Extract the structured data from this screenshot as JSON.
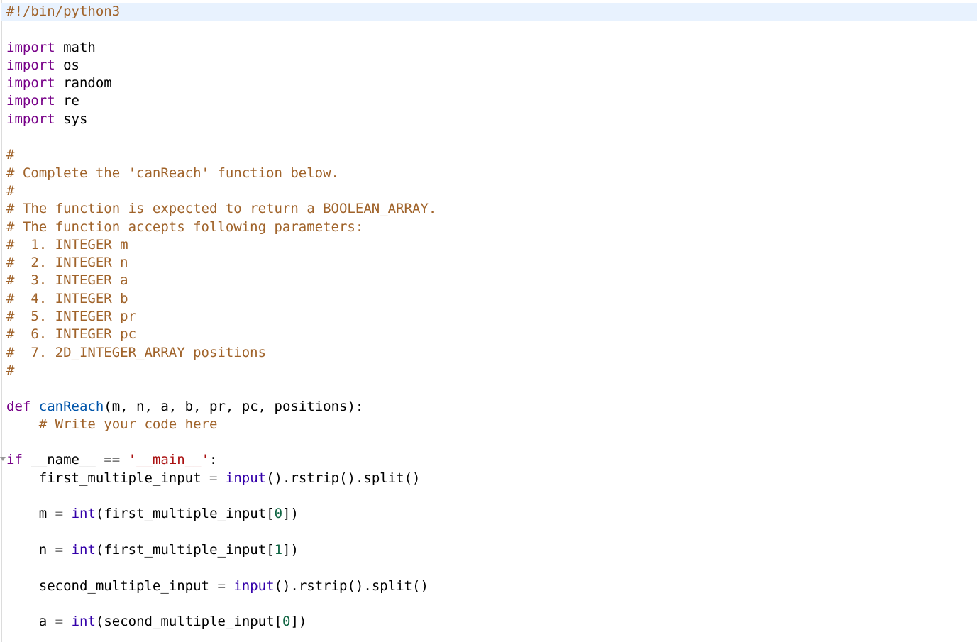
{
  "editor": {
    "language": "python",
    "colors": {
      "keyword": "#770088",
      "comment": "#a0632a",
      "function": "#0055aa",
      "builtin": "#3300aa",
      "string": "#aa1111",
      "number": "#116644",
      "current_line_bg": "#e8f2fe"
    },
    "lines": [
      "#!/bin/python3",
      "",
      "import math",
      "import os",
      "import random",
      "import re",
      "import sys",
      "",
      "#",
      "# Complete the 'canReach' function below.",
      "#",
      "# The function is expected to return a BOOLEAN_ARRAY.",
      "# The function accepts following parameters:",
      "#  1. INTEGER m",
      "#  2. INTEGER n",
      "#  3. INTEGER a",
      "#  4. INTEGER b",
      "#  5. INTEGER pr",
      "#  6. INTEGER pc",
      "#  7. 2D_INTEGER_ARRAY positions",
      "#",
      "",
      "def canReach(m, n, a, b, pr, pc, positions):",
      "    # Write your code here",
      "",
      "if __name__ == '__main__':",
      "    first_multiple_input = input().rstrip().split()",
      "",
      "    m = int(first_multiple_input[0])",
      "",
      "    n = int(first_multiple_input[1])",
      "",
      "    second_multiple_input = input().rstrip().split()",
      "",
      "    a = int(second_multiple_input[0])"
    ],
    "tokens": {
      "shebang": "#!/bin/python3",
      "import_kw": "import",
      "modules": [
        "math",
        "os",
        "random",
        "re",
        "sys"
      ],
      "hash": "#",
      "comment_complete": "# Complete the 'canReach' function below.",
      "comment_return": "# The function is expected to return a BOOLEAN_ARRAY.",
      "comment_params": "# The function accepts following parameters:",
      "params": [
        "#  1. INTEGER m",
        "#  2. INTEGER n",
        "#  3. INTEGER a",
        "#  4. INTEGER b",
        "#  5. INTEGER pr",
        "#  6. INTEGER pc",
        "#  7. 2D_INTEGER_ARRAY positions"
      ],
      "def_kw": "def",
      "func_name": "canReach",
      "func_args": "(m, n, a, b, pr, pc, positions):",
      "write_code_comment": "# Write your code here",
      "if_kw": "if",
      "name_var": "__name__",
      "eq_op": "==",
      "main_str": "'__main__'",
      "colon": ":",
      "first_var": "first_multiple_input",
      "second_var": "second_multiple_input",
      "assign": "=",
      "input_fn": "input",
      "rstrip_split": "().rstrip().split()",
      "int_fn": "int",
      "m_var": "m",
      "n_var": "n",
      "a_var": "a",
      "idx0": "0",
      "idx1": "1",
      "open_paren": "(",
      "open_bracket": "[",
      "close_bracket_paren": "])"
    }
  }
}
